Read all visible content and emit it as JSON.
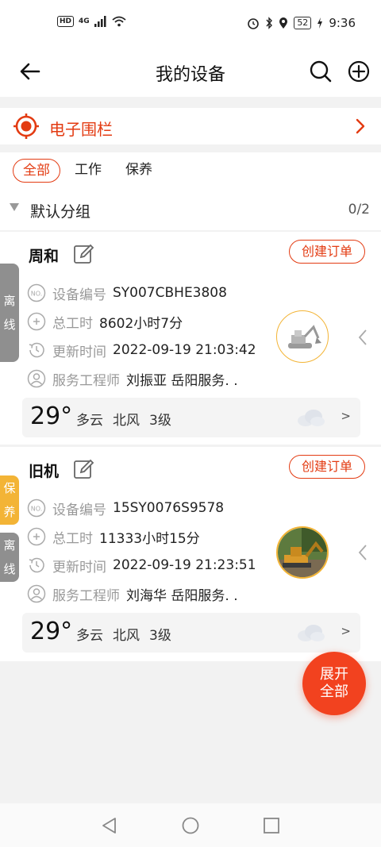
{
  "status_bar": {
    "hd": "HD",
    "network": "4G",
    "battery": "52",
    "time": "9:36"
  },
  "header": {
    "title": "我的设备"
  },
  "fence": {
    "label": "电子围栏"
  },
  "tabs": [
    {
      "label": "全部",
      "active": true
    },
    {
      "label": "工作",
      "active": false
    },
    {
      "label": "保养",
      "active": false
    }
  ],
  "group": {
    "label": "默认分组",
    "count": "0/2"
  },
  "labels": {
    "device_no": "设备编号",
    "total_hours": "总工时",
    "update_time": "更新时间",
    "engineer": "服务工程师",
    "create_order": "创建订单"
  },
  "devices": [
    {
      "name": "周和",
      "tags": [
        "离\n线"
      ],
      "device_no": "SY007CBHE3808",
      "total_hours": "8602小时7分",
      "update_time": "2022-09-19 21:03:42",
      "engineer": "刘振亚 岳阳服务. .",
      "weather": {
        "temp": "29°",
        "desc": "多云",
        "wind_dir": "北风",
        "wind_level": "3级",
        "more": ">"
      }
    },
    {
      "name": "旧机",
      "tags": [
        "保\n养",
        "离\n线"
      ],
      "device_no": "15SY0076S9578",
      "total_hours": "11333小时15分",
      "update_time": "2022-09-19 21:23:51",
      "engineer": "刘海华 岳阳服务. .",
      "weather": {
        "temp": "29°",
        "desc": "多云",
        "wind_dir": "北风",
        "wind_level": "3级",
        "more": ">"
      }
    }
  ],
  "fab": {
    "line1": "展开",
    "line2": "全部"
  },
  "colors": {
    "accent": "#e33b12",
    "fab": "#f2421f",
    "offline_tag": "#8f8f8f",
    "maintenance_tag": "#f3b436"
  }
}
